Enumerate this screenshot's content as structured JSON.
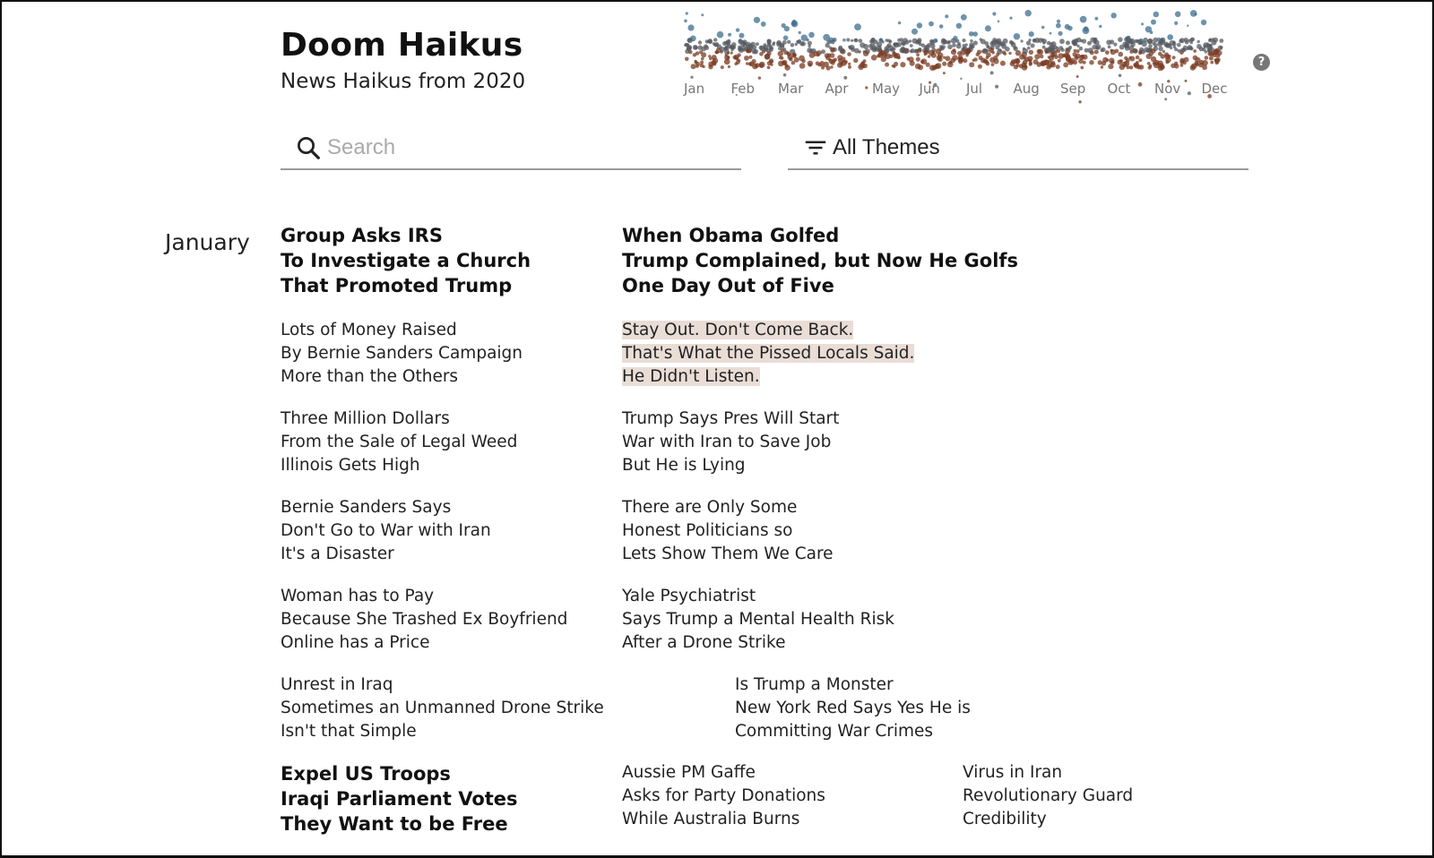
{
  "header": {
    "title": "Doom Haikus",
    "subtitle": "News Haikus from 2020",
    "help_icon": "question-circle-icon"
  },
  "timeline": {
    "months": [
      "Jan",
      "Feb",
      "Mar",
      "Apr",
      "May",
      "Jun",
      "Jul",
      "Aug",
      "Sep",
      "Oct",
      "Nov",
      "Dec"
    ],
    "colors": {
      "low": "#7a3b22",
      "mid": "#555a60",
      "high": "#3d6f8e"
    }
  },
  "search": {
    "placeholder": "Search",
    "value": "",
    "icon": "search-icon"
  },
  "filter": {
    "label": "All Themes",
    "icon": "filter-icon"
  },
  "sections": [
    {
      "month": "January",
      "haikus": [
        {
          "lines": [
            "Group Asks IRS",
            "To Investigate a Church",
            "That Promoted Trump"
          ],
          "style": "bold"
        },
        {
          "lines": [
            "When Obama Golfed",
            "Trump Complained, but Now He Golfs",
            "One Day Out of Five"
          ],
          "style": "bold"
        },
        {
          "lines": [
            "Lots of Money Raised",
            "By Bernie Sanders Campaign",
            "More than the Others"
          ],
          "style": "normal"
        },
        {
          "lines": [
            "Stay Out. Don't Come Back.",
            "That's What the Pissed Locals Said.",
            "He Didn't Listen."
          ],
          "style": "highlighted"
        },
        {
          "lines": [
            "Three Million Dollars",
            "From the Sale of Legal Weed",
            "Illinois Gets High"
          ],
          "style": "normal"
        },
        {
          "lines": [
            "Trump Says Pres Will Start",
            "War with Iran to Save Job",
            "But He is Lying"
          ],
          "style": "normal"
        },
        {
          "lines": [
            "Bernie Sanders Says",
            "Don't Go to War with Iran",
            "It's a Disaster"
          ],
          "style": "normal"
        },
        {
          "lines": [
            "There are Only Some",
            "Honest Politicians so",
            "Lets Show Them We Care"
          ],
          "style": "normal"
        },
        {
          "lines": [
            "Woman has to Pay",
            "Because She Trashed Ex Boyfriend",
            "Online has a Price"
          ],
          "style": "normal"
        },
        {
          "lines": [
            "Yale Psychiatrist",
            "Says Trump a Mental Health Risk",
            "After a Drone Strike"
          ],
          "style": "normal"
        },
        {
          "lines": [
            "Unrest in Iraq",
            "Sometimes an Unmanned Drone Strike",
            "Isn't that Simple"
          ],
          "style": "normal"
        },
        {
          "lines": [
            "Is Trump a Monster",
            "New York Red Says Yes He is",
            "Committing War Crimes"
          ],
          "style": "normal"
        },
        {
          "lines": [
            "Expel US Troops",
            "Iraqi Parliament Votes",
            "They Want to be Free"
          ],
          "style": "bold"
        },
        {
          "lines": [
            "Aussie PM Gaffe",
            "Asks for Party Donations",
            "While Australia Burns"
          ],
          "style": "normal"
        },
        {
          "lines": [
            "Virus in Iran",
            "Revolutionary Guard",
            "Credibility"
          ],
          "style": "normal"
        }
      ]
    }
  ]
}
